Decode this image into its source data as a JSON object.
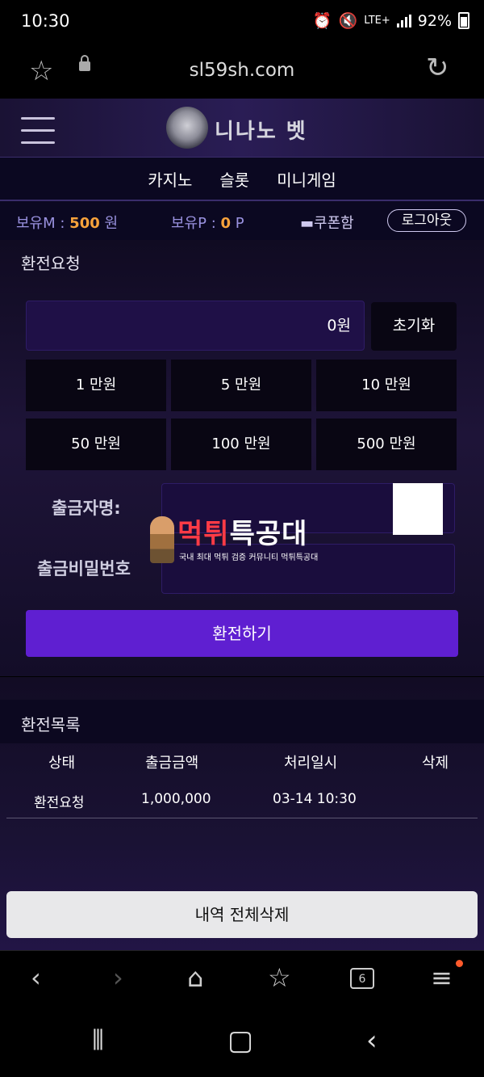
{
  "status_bar": {
    "time": "10:30",
    "network": "LTE+",
    "battery": "92%",
    "icons": [
      "alarm-icon",
      "mute-icon",
      "signal-icon",
      "battery-icon"
    ]
  },
  "browser": {
    "url": "sl59sh.com",
    "tab_count": "6"
  },
  "site": {
    "logo_text": "니나노 벳",
    "nav": [
      "카지노",
      "슬롯",
      "미니게임"
    ],
    "balance": {
      "m_label": "보유M :",
      "m_value": "500",
      "m_unit": "원",
      "p_label": "보유P :",
      "p_value": "0",
      "p_unit": "P",
      "coupon": "쿠폰함",
      "logout": "로그아웃"
    }
  },
  "exchange": {
    "title": "환전요청",
    "amount": "0원",
    "reset": "초기화",
    "chips": [
      "1 만원",
      "5 만원",
      "10 만원",
      "50 만원",
      "100 만원",
      "500 만원"
    ],
    "depositor_label": "출금자명:",
    "password_label": "출금비밀번호",
    "submit": "환전하기"
  },
  "watermark": {
    "title_a": "먹튀",
    "title_b": "특공대",
    "subtitle": "국내 최대 먹튀 검증 커뮤니티 먹튀특공대"
  },
  "history": {
    "title": "환전목록",
    "columns": [
      "상태",
      "출금금액",
      "처리일시",
      "삭제"
    ],
    "rows": [
      {
        "status": "환전요청",
        "amount": "1,000,000",
        "time": "03-14 10:30",
        "delete": ""
      }
    ],
    "clear_all": "내역 전체삭제"
  },
  "colors": {
    "accent": "#5f1fd1",
    "balance_value": "#f7a23b",
    "label_purple": "#9a92e0"
  }
}
